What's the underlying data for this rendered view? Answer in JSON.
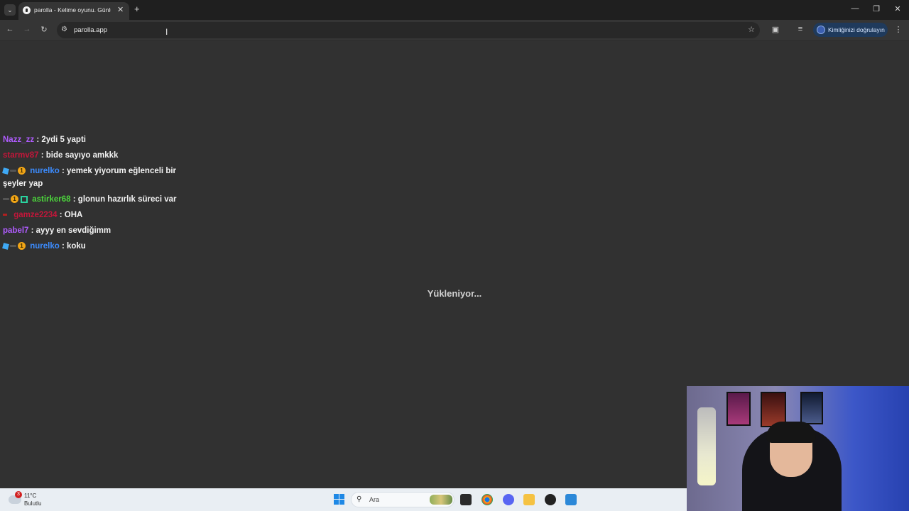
{
  "browser": {
    "tab_title": "parolla - Kelime oyunu. Günlük",
    "url": "parolla.app",
    "verify_label": "Kimliğinizi doğrulayın"
  },
  "chat": {
    "messages": [
      {
        "user": "Nazz_zz",
        "user_color": "#b05cff",
        "text": ": 2ydi 5 yapti"
      },
      {
        "user": "starmv87",
        "user_color": "#c4163a",
        "text": ": bide sayıyo amkkk"
      },
      {
        "user": "nurelko",
        "user_color": "#3c8cff",
        "text": ": yemek yiyorum eğlenceli bir şeyler yap"
      },
      {
        "user": "astirker68",
        "user_color": "#4cd63c",
        "text": ": glonun hazırlık süreci var"
      },
      {
        "user": "gamze2234",
        "user_color": "#c4163a",
        "text": ": OHA"
      },
      {
        "user": "pabel7",
        "user_color": "#b05cff",
        "text": ": ayyy en sevdiğimm"
      },
      {
        "user": "nurelko",
        "user_color": "#3c8cff",
        "text": ": koku"
      }
    ],
    "badge_coin": "1"
  },
  "main": {
    "loading_text": "Yükleniyor..."
  },
  "taskbar": {
    "weather_badge": "3",
    "weather_temp": "11°C",
    "weather_desc": "Bulutlu",
    "search_label": "Ara"
  }
}
